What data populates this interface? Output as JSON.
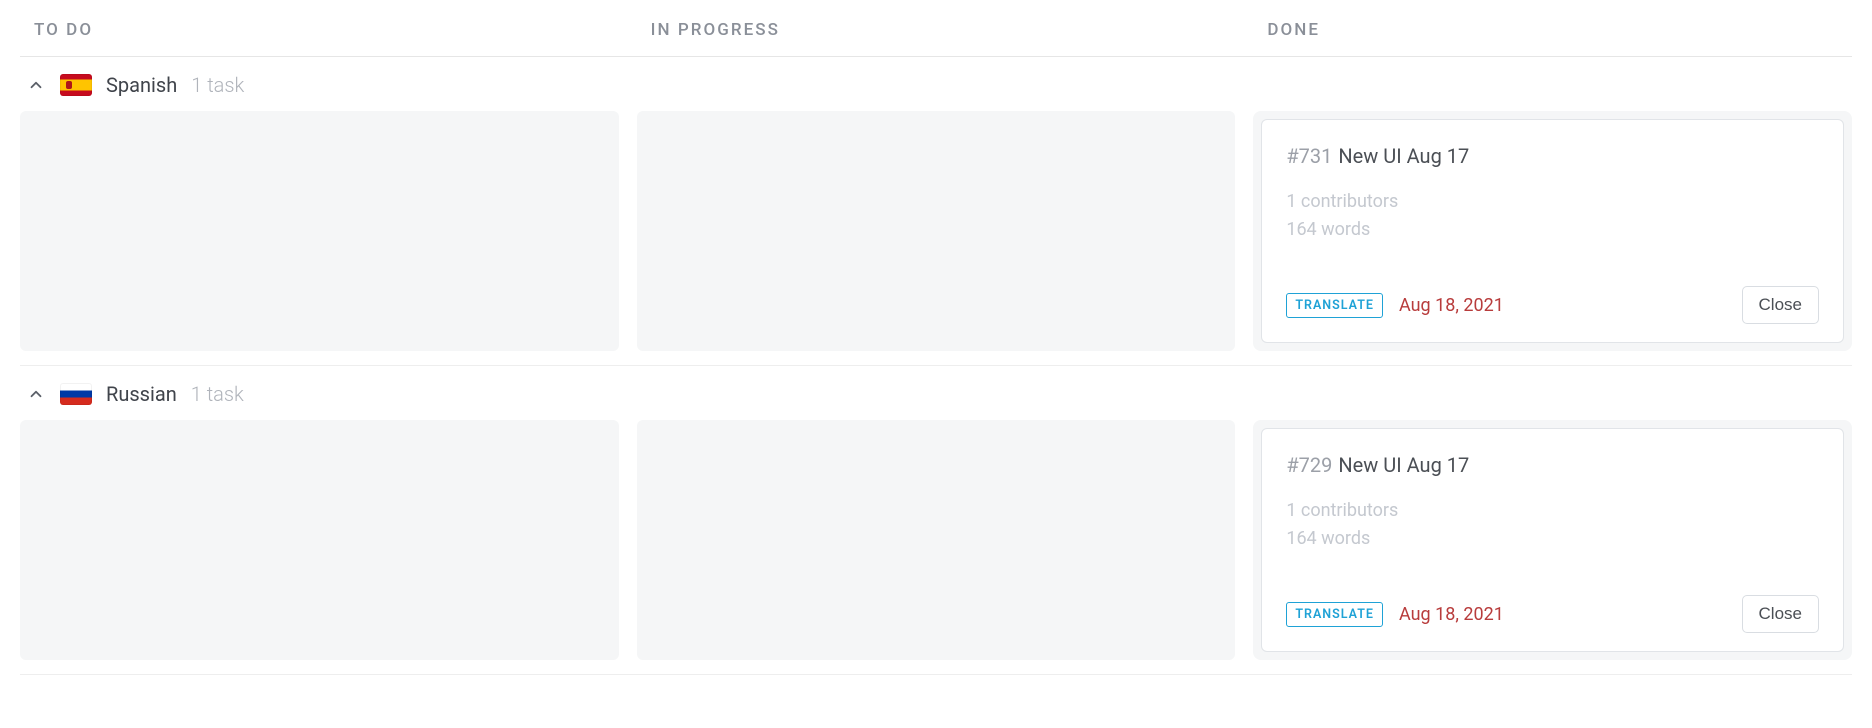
{
  "columns": {
    "todo": "TO DO",
    "in_progress": "IN PROGRESS",
    "done": "DONE"
  },
  "groups": [
    {
      "flag": "es",
      "language": "Spanish",
      "task_count": "1 task",
      "card": {
        "id": "#731",
        "title": "New UI Aug 17",
        "contributors": "1 contributors",
        "words": "164 words",
        "badge": "TRANSLATE",
        "due": "Aug 18, 2021",
        "close": "Close"
      }
    },
    {
      "flag": "ru",
      "language": "Russian",
      "task_count": "1 task",
      "card": {
        "id": "#729",
        "title": "New UI Aug 17",
        "contributors": "1 contributors",
        "words": "164 words",
        "badge": "TRANSLATE",
        "due": "Aug 18, 2021",
        "close": "Close"
      }
    }
  ]
}
